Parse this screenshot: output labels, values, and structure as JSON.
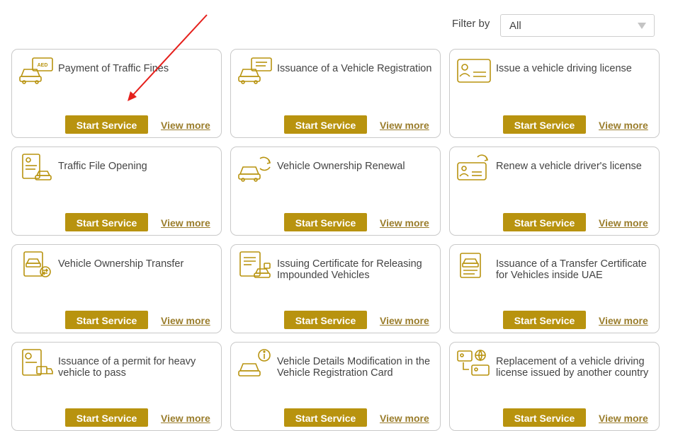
{
  "filter": {
    "label": "Filter by",
    "value": "All"
  },
  "accent_color": "#b8930f",
  "cards": [
    {
      "title": "Payment of Traffic Fines",
      "icon": "car-fine-icon",
      "start_label": "Start Service",
      "more_label": "View more"
    },
    {
      "title": "Issuance of a Vehicle Registration",
      "icon": "car-registration-icon",
      "start_label": "Start Service",
      "more_label": "View more"
    },
    {
      "title": "Issue a vehicle driving license",
      "icon": "license-card-icon",
      "start_label": "Start Service",
      "more_label": "View more"
    },
    {
      "title": "Traffic File Opening",
      "icon": "traffic-file-icon",
      "start_label": "Start Service",
      "more_label": "View more"
    },
    {
      "title": "Vehicle Ownership Renewal",
      "icon": "car-renew-icon",
      "start_label": "Start Service",
      "more_label": "View more"
    },
    {
      "title": "Renew a vehicle driver's license",
      "icon": "license-renew-icon",
      "start_label": "Start Service",
      "more_label": "View more"
    },
    {
      "title": "Vehicle Ownership Transfer",
      "icon": "ownership-transfer-icon",
      "start_label": "Start Service",
      "more_label": "View more"
    },
    {
      "title": "Issuing Certificate for Releasing Impounded Vehicles",
      "icon": "impound-certificate-icon",
      "start_label": "Start Service",
      "more_label": "View more"
    },
    {
      "title": "Issuance of a Transfer Certificate for Vehicles inside UAE",
      "icon": "transfer-certificate-icon",
      "start_label": "Start Service",
      "more_label": "View more"
    },
    {
      "title": "Issuance of a permit for heavy vehicle to pass",
      "icon": "heavy-vehicle-permit-icon",
      "start_label": "Start Service",
      "more_label": "View more"
    },
    {
      "title": "Vehicle Details Modification in the Vehicle Registration Card",
      "icon": "car-info-icon",
      "start_label": "Start Service",
      "more_label": "View more"
    },
    {
      "title": "Replacement of a vehicle driving license issued by another country",
      "icon": "license-exchange-icon",
      "start_label": "Start Service",
      "more_label": "View more"
    }
  ],
  "fine_icon_text": "AED"
}
